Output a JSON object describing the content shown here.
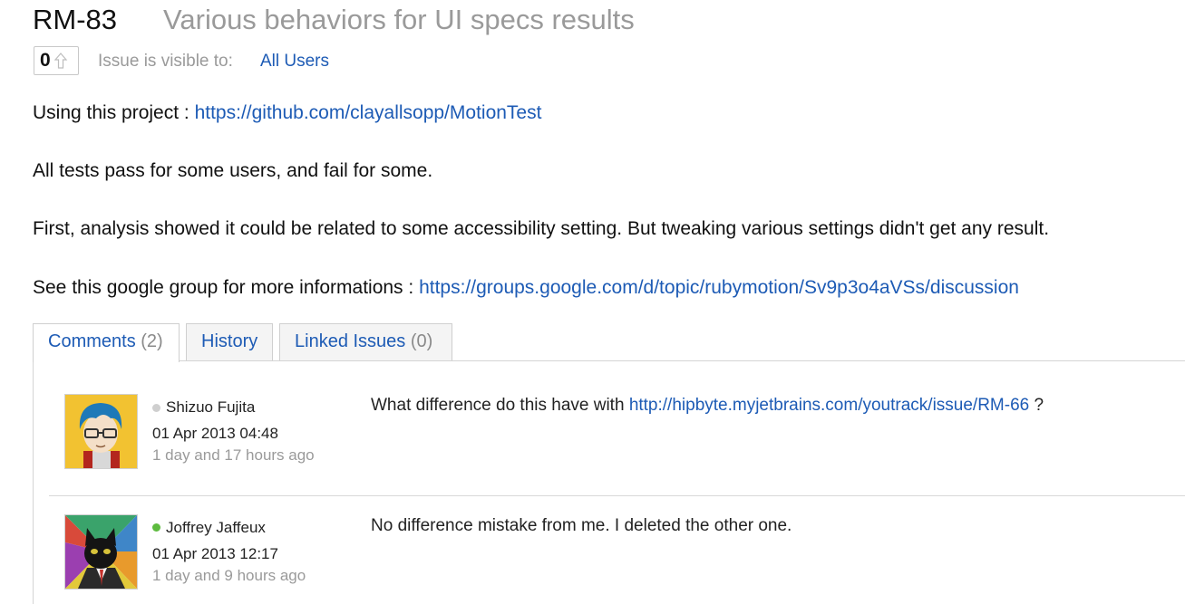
{
  "issue": {
    "id": "RM-83",
    "title": "Various behaviors for UI specs results",
    "votes": "0",
    "visibility_label": "Issue is visible to:",
    "visibility_value": "All Users"
  },
  "description": {
    "p1_text": "Using this project : ",
    "p1_link": "https://github.com/clayallsopp/MotionTest",
    "p2_text": "All tests pass for some users, and fail for some.",
    "p3_text": "First, analysis showed it could be related to some accessibility setting. But tweaking various settings didn't get any result.",
    "p4_text": "See this google group for more informations : ",
    "p4_link": "https://groups.google.com/d/topic/rubymotion/Sv9p3o4aVSs/discussion"
  },
  "tabs": [
    {
      "label": "Comments",
      "count": "(2)"
    },
    {
      "label": "History",
      "count": ""
    },
    {
      "label": "Linked Issues",
      "count": "(0)"
    }
  ],
  "comments": [
    {
      "author": "Shizuo Fujita",
      "status": "offline",
      "status_color": "#cfcfcf",
      "date": "01 Apr 2013 04:48",
      "ago": "1 day and 17 hours ago",
      "text_before": "What difference do this have with ",
      "link": "http://hipbyte.myjetbrains.com/youtrack/issue/RM-66",
      "text_after": " ?"
    },
    {
      "author": "Joffrey Jaffeux",
      "status": "online",
      "status_color": "#5dbb3f",
      "date": "01 Apr 2013 12:17",
      "ago": "1 day and 9 hours ago",
      "text": "No difference mistake from me. I deleted the other one."
    }
  ],
  "colors": {
    "link": "#1d5bb5",
    "muted": "#9a9a9a"
  }
}
